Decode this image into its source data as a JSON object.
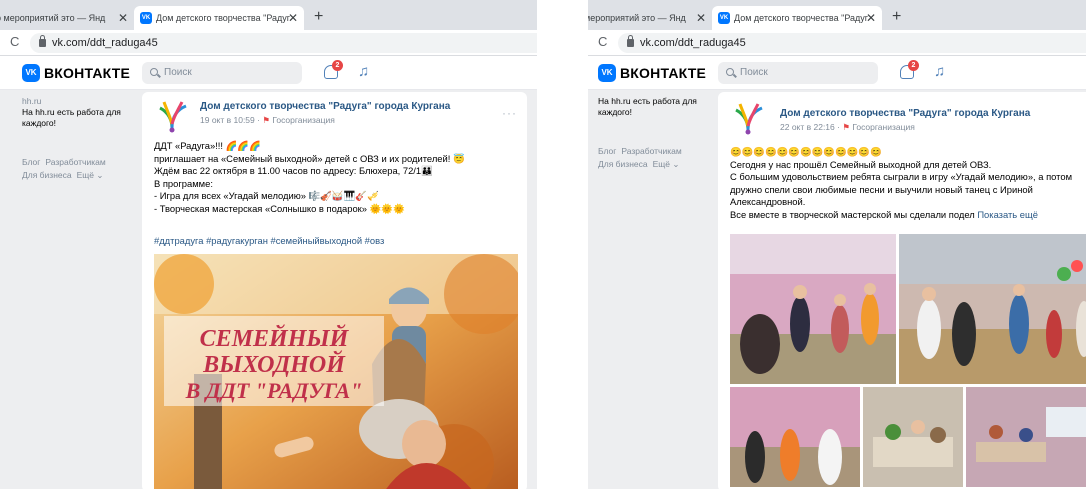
{
  "window1": {
    "tab_inactive": "р мероприятий это — Янд",
    "tab_active": "Дом детского творчества \"Радуг",
    "vk_icon": "vk-logo-icon",
    "url": "vk.com/ddt_raduga45",
    "brand": "ВКОНТАКТЕ",
    "search_placeholder": "Поиск",
    "notif_count": "2",
    "sidebar": {
      "cut_line": "hh.ru",
      "promo": [
        "На hh.ru есть работа для",
        "каждого!"
      ],
      "links": [
        "Блог",
        "Разработчикам"
      ],
      "links2": [
        "Для бизнеса",
        "Ещё ⌄"
      ]
    },
    "post": {
      "group": "Дом детского творчества \"Радуга\" города Кургана",
      "date": "19 окт в 10:59",
      "type": "Госорганизация",
      "lines": [
        "ДДТ «Радуга»!!! 🌈🌈🌈",
        "приглашает на «Семейный выходной» детей с ОВЗ и их родителей! 😇",
        "Ждём вас 22 октября в 11.00 часов по адресу: Блюхера, 72/1👪",
        "В программе:",
        "- Игра для всех «Угадай мелодию» 🎼🎻🥁🎹🎸🎺",
        "- Творческая мастерская «Солнышко в подарок» 🌞🌞🌞"
      ],
      "hashtags": "#ддтрадуга #радугакурган #семейныйвыходной #овз",
      "poster_line1": "СЕМЕЙНЫЙ",
      "poster_line2": "ВЫХОДНОЙ",
      "poster_line3": "В ДДТ \"РАДУГА\""
    }
  },
  "window2": {
    "tab_inactive": "мероприятий это — Янд",
    "tab_active": "Дом детского творчества \"Радуг",
    "url": "vk.com/ddt_raduga45",
    "brand": "ВКОНТАКТЕ",
    "search_placeholder": "Поиск",
    "notif_count": "2",
    "sidebar": {
      "promo": [
        "На hh.ru есть работа для",
        "каждого!"
      ],
      "links": [
        "Блог",
        "Разработчикам"
      ],
      "links2": [
        "Для бизнеса",
        "Ещё ⌄"
      ]
    },
    "post": {
      "group": "Дом детского творчества \"Радуга\" города Кургана",
      "date": "22 окт в 22:16",
      "type": "Госорганизация",
      "emoji_line": "😊😊😊😊😊😊😊😊😊😊😊😊😊",
      "lines": [
        "Сегодня у нас прошёл Семейный выходной для детей ОВЗ.",
        "С большим удовольствием ребята сыграли в игру «Угадай мелодию», а потом",
        "дружно спели свои любимые песни и выучили новый танец с Ириной",
        "Александровной.",
        "Все вместе в творческой мастерской мы сделали подел"
      ],
      "show_more": "Показать ещё"
    }
  },
  "colors": {
    "vk_blue": "#0077ff",
    "link": "#2a5885",
    "bg": "#edeef0"
  }
}
